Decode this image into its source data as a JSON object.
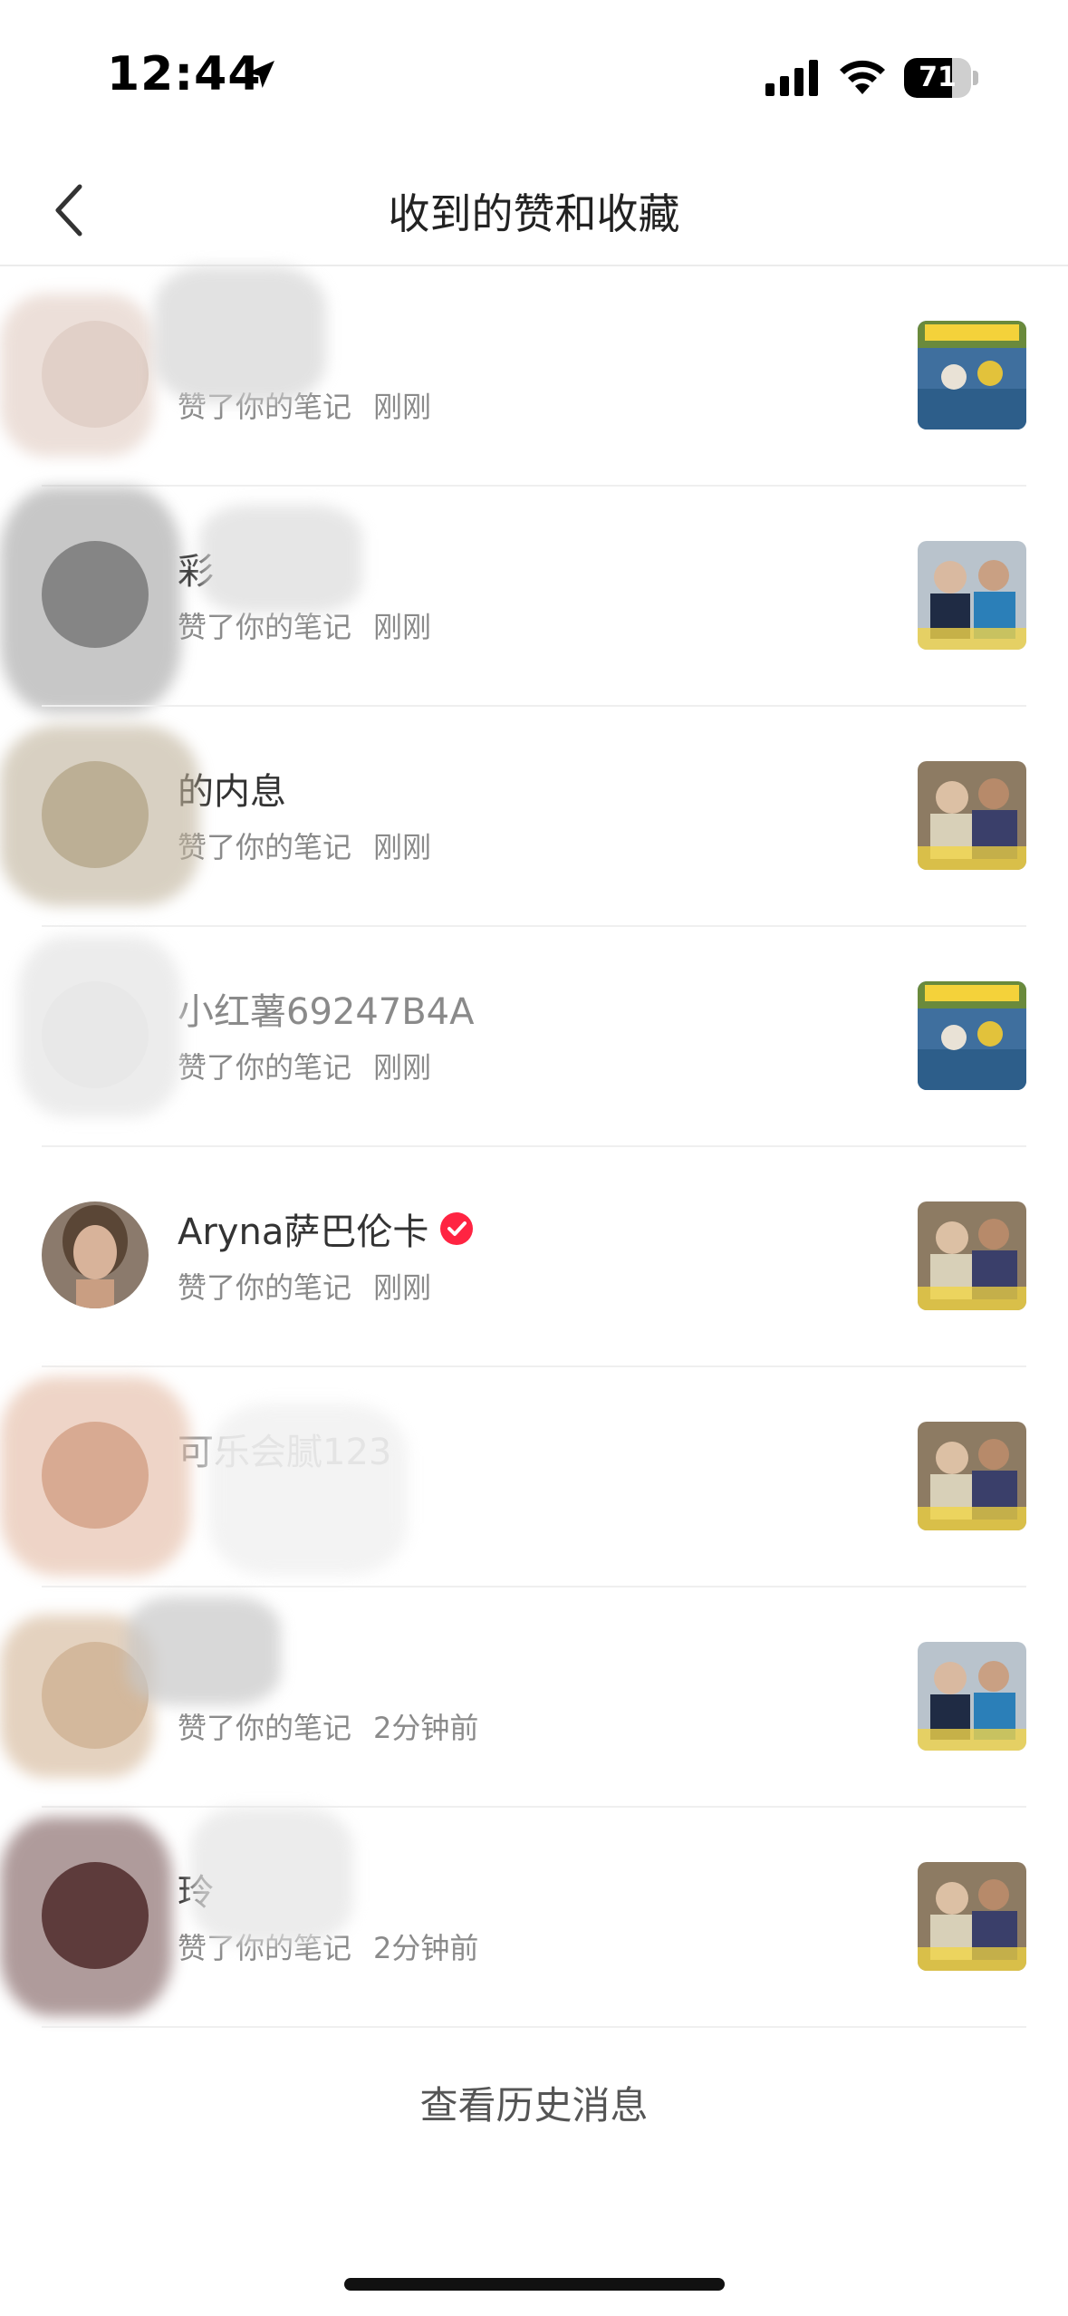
{
  "status_bar": {
    "time": "12:44",
    "battery": "71",
    "battery_level": 0.71
  },
  "nav": {
    "title": "收到的赞和收藏",
    "back_icon": "chevron-left-icon"
  },
  "items": [
    {
      "name": "",
      "action": "赞了你的笔记",
      "time": "刚刚",
      "verified": false,
      "thumb": "soccer"
    },
    {
      "name": "彩",
      "action": "赞了你的笔记",
      "time": "刚刚",
      "verified": false,
      "thumb": "blue"
    },
    {
      "name": "的内息",
      "action": "赞了你的笔记",
      "time": "刚刚",
      "verified": false,
      "thumb": "warm"
    },
    {
      "name": "小红薯69247B4A",
      "action": "赞了你的笔记",
      "time": "刚刚",
      "verified": false,
      "thumb": "soccer"
    },
    {
      "name": "Aryna萨巴伦卡",
      "action": "赞了你的笔记",
      "time": "刚刚",
      "verified": true,
      "thumb": "warm"
    },
    {
      "name": "可乐会腻123",
      "action": "",
      "time": "",
      "verified": false,
      "thumb": "warm"
    },
    {
      "name": "",
      "action": "赞了你的笔记",
      "time": "2分钟前",
      "verified": false,
      "thumb": "blue"
    },
    {
      "name": "玲",
      "action": "赞了你的笔记",
      "time": "2分钟前",
      "verified": false,
      "thumb": "warm"
    }
  ],
  "footer": {
    "history_link": "查看历史消息"
  },
  "colors": {
    "verified": "#ff2442",
    "divider": "#efefef",
    "subtext": "#8a8a8a"
  }
}
